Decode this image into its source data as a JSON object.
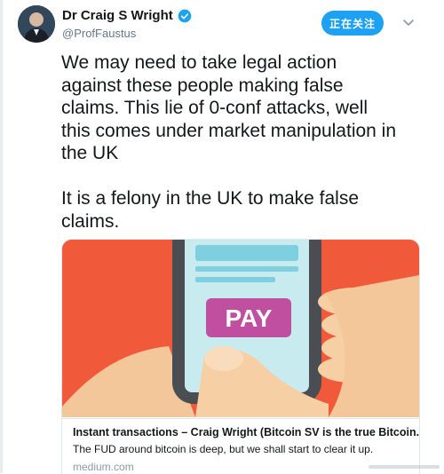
{
  "tweet": {
    "author": {
      "display_name": "Dr Craig S Wright",
      "handle": "@ProfFaustus",
      "verified": true
    },
    "follow_button_label": "正在关注",
    "text": "We may need to take legal action\nagainst these people making false\nclaims. This lie of 0-conf attacks, well\nthis comes under market manipulation in\nthe UK\n\nIt is a felony in the UK to make false\nclaims.",
    "card": {
      "image_badge": "PAY",
      "title": "Instant transactions – Craig Wright (Bitcoin SV is the true Bitcoin.) – ...",
      "description": "The FUD around bitcoin is deep, but we shall start to clear it up.",
      "domain": "medium.com"
    }
  },
  "colors": {
    "accent": "#1da1f2",
    "card_image_background": "#f05a3a",
    "pay_badge": "#c0509f"
  },
  "icons": [
    "verified-badge-icon",
    "chevron-down-icon"
  ]
}
